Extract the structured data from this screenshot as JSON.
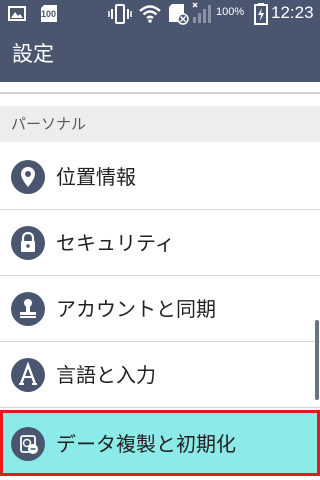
{
  "status_bar": {
    "icons": [
      "image-icon",
      "sd-card-icon",
      "vibrate-icon",
      "wifi-icon",
      "sim-error-icon",
      "signal-icon",
      "battery-charging-icon"
    ],
    "badge": "100",
    "battery_percent": "100%",
    "time": "12:23"
  },
  "action_bar": {
    "title": "設定"
  },
  "section": {
    "title": "パーソナル"
  },
  "items": [
    {
      "label": "位置情報",
      "icon": "location-pin-icon"
    },
    {
      "label": "セキュリティ",
      "icon": "lock-icon"
    },
    {
      "label": "アカウントと同期",
      "icon": "account-stamp-icon"
    },
    {
      "label": "言語と入力",
      "icon": "language-a-icon"
    },
    {
      "label": "データ複製と初期化",
      "icon": "backup-restore-icon",
      "highlighted": true
    }
  ],
  "colors": {
    "header_bg": "#4a5670",
    "highlight_bg": "#8ceae8",
    "highlight_border": "#e8161d"
  }
}
